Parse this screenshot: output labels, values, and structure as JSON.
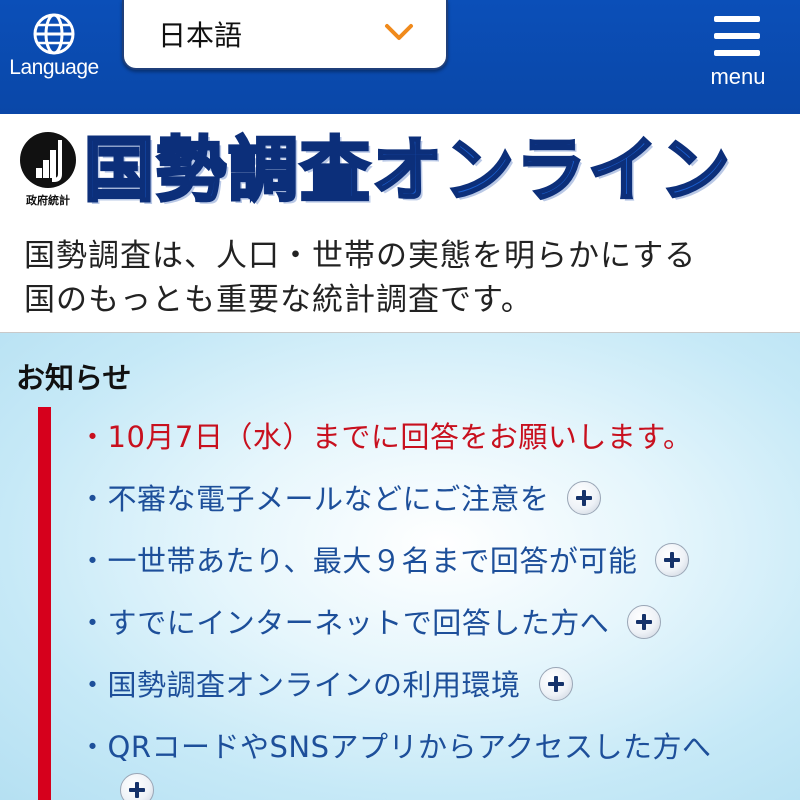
{
  "header": {
    "language_label": "Language",
    "language_selected": "日本語",
    "menu_label": "menu",
    "icons": {
      "language": "globe-icon",
      "dropdown": "chevron-down-icon",
      "menu": "hamburger-icon"
    },
    "colors": {
      "bar": "#0b4fb8",
      "chevron": "#f08a1c"
    }
  },
  "logo": {
    "gov_label": "政府統計",
    "site_title": "国勢調査オンライン",
    "colors": {
      "title_fill": "#1a5fd0",
      "title_outline": "#0c2f7a"
    }
  },
  "description": {
    "line1": "国勢調査は、人口・世帯の実態を明らかにする",
    "line2": "国のもっとも重要な統計調査です。"
  },
  "news": {
    "heading": "お知らせ",
    "accent_color": "#d6001c",
    "items": [
      {
        "text": "・10月7日（水）までに回答をお願いします。",
        "expandable": false,
        "alert": true
      },
      {
        "text": "・不審な電子メールなどにご注意を",
        "expandable": true
      },
      {
        "text": "・一世帯あたり、最大９名まで回答が可能",
        "expandable": true
      },
      {
        "text": "・すでにインターネットで回答した方へ",
        "expandable": true
      },
      {
        "text": "・国勢調査オンラインの利用環境",
        "expandable": true
      },
      {
        "text": "・QRコードやSNSアプリからアクセスした方へ",
        "expandable": true
      }
    ]
  }
}
